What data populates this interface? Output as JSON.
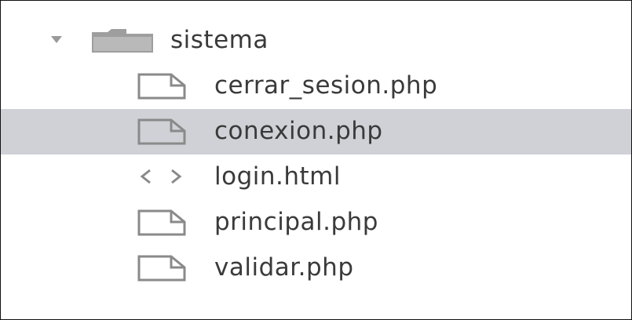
{
  "tree": {
    "folder": {
      "name": "sistema",
      "icon": "folder-icon",
      "expanded": true
    },
    "files": [
      {
        "name": "cerrar_sesion.php",
        "icon": "file-icon",
        "selected": false
      },
      {
        "name": "conexion.php",
        "icon": "file-icon",
        "selected": true
      },
      {
        "name": "login.html",
        "icon": "code-icon",
        "selected": false
      },
      {
        "name": "principal.php",
        "icon": "file-icon",
        "selected": false
      },
      {
        "name": "validar.php",
        "icon": "file-icon",
        "selected": false
      }
    ]
  },
  "colors": {
    "selection": "#cfd1d6",
    "text": "#3a3a3a",
    "icon": "#8a8a8a",
    "border": "#111111"
  }
}
